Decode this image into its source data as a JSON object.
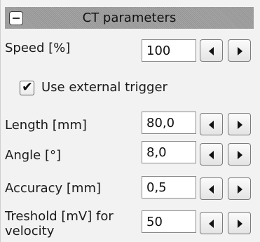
{
  "panel": {
    "title": "CT parameters",
    "collapse_symbol": "−"
  },
  "rows": [
    {
      "label": "Speed [%]",
      "value": "100"
    },
    {
      "label": "Length [mm]",
      "value": "80,0"
    },
    {
      "label": "Angle [°]",
      "value": "8,0"
    },
    {
      "label": "Accuracy [mm]",
      "value": "0,5"
    },
    {
      "label": "Treshold [mV] for velocity",
      "value": "50"
    }
  ],
  "external_trigger": {
    "label": "Use external trigger",
    "checked": true
  },
  "icons": {
    "collapse": "minus-icon",
    "decrement": "arrow-left-icon",
    "increment": "arrow-right-icon",
    "check": "checkmark-icon"
  },
  "colors": {
    "header_bg": "#9d9d9d",
    "panel_bg": "#f2f2f2",
    "input_bg": "#ffffff"
  }
}
